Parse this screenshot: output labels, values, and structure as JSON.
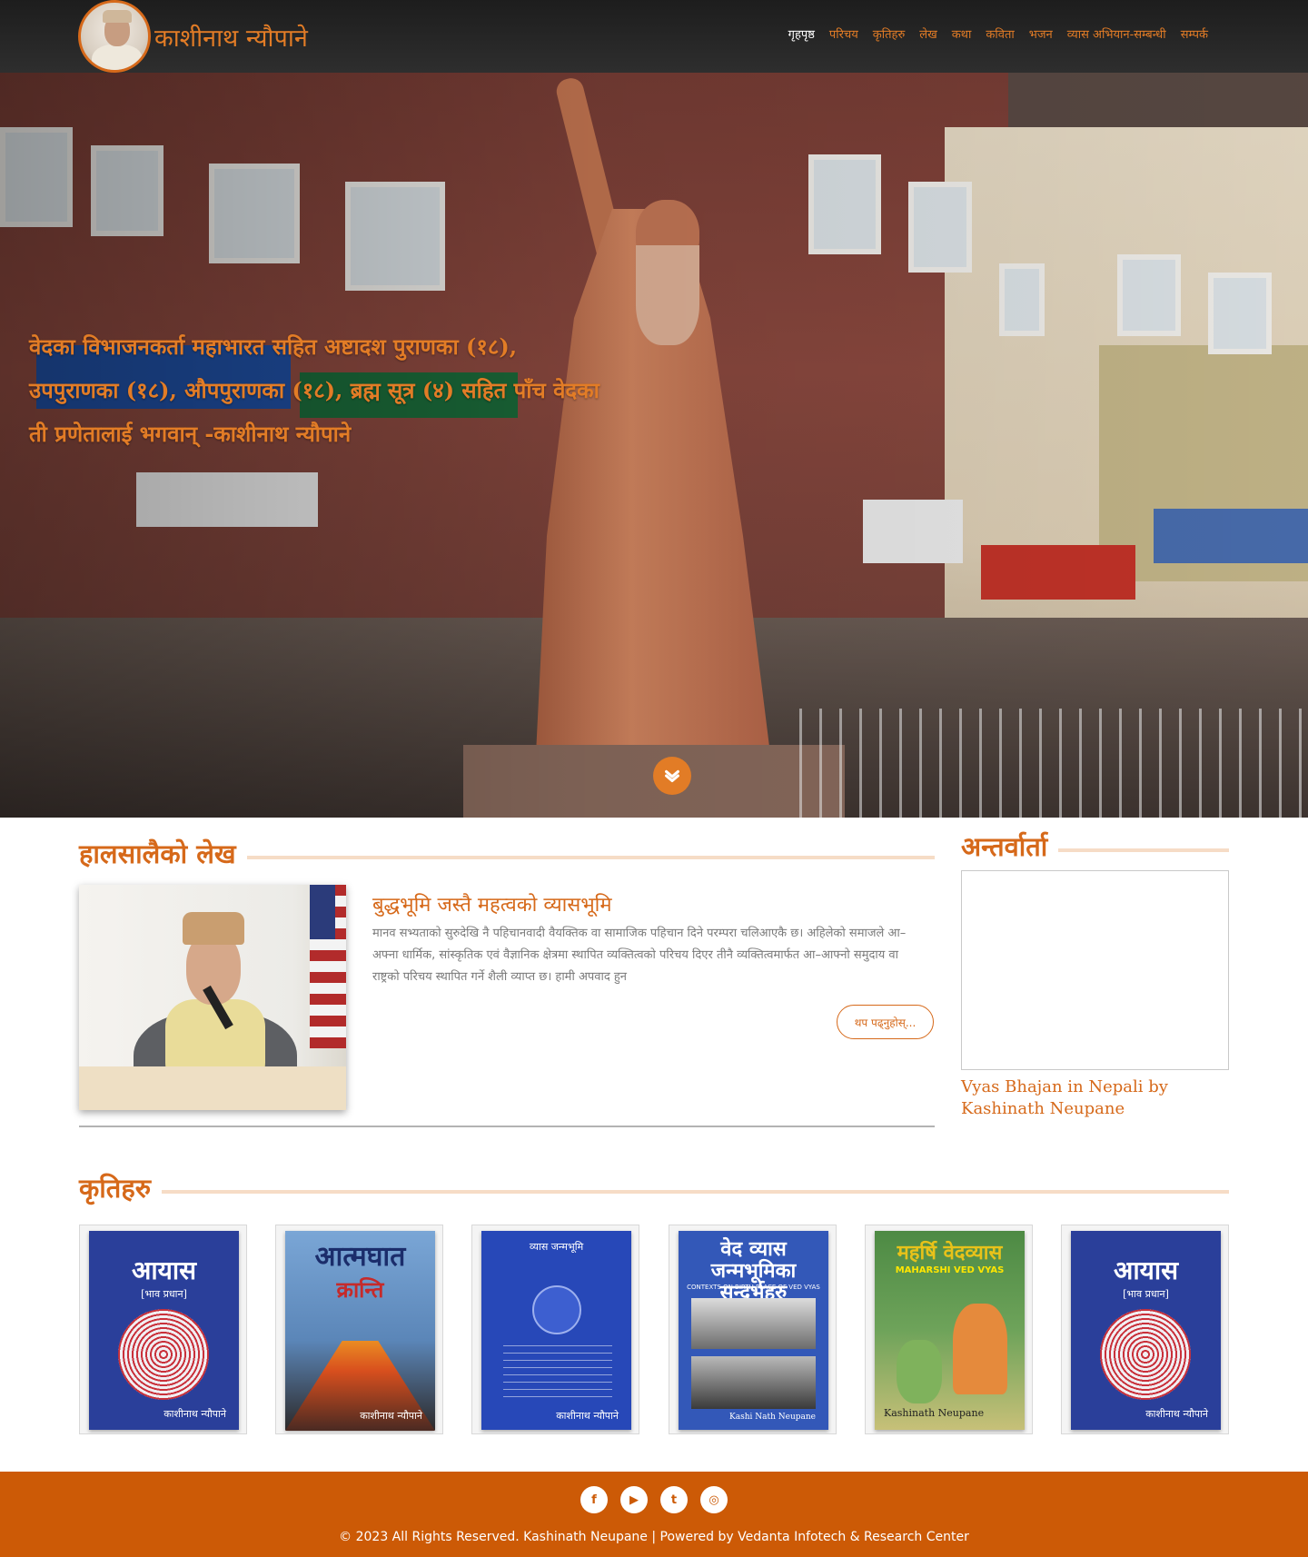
{
  "header": {
    "site_name": "काशीनाथ न्यौपाने",
    "nav": [
      {
        "label": "गृहपृष्ठ",
        "active": true
      },
      {
        "label": "परिचय",
        "active": false
      },
      {
        "label": "कृतिहरु",
        "active": false
      },
      {
        "label": "लेख",
        "active": false
      },
      {
        "label": "कथा",
        "active": false
      },
      {
        "label": "कविता",
        "active": false
      },
      {
        "label": "भजन",
        "active": false
      },
      {
        "label": "व्यास अभियान-सम्बन्धी",
        "active": false
      },
      {
        "label": "सम्पर्क",
        "active": false
      }
    ]
  },
  "hero": {
    "quote": "वेदका विभाजनकर्ता महाभारत सहित अष्टादश पुराणका (१८), उपपुराणका (१८), औपपुराणका (१८), ब्रह्म सूत्र (४) सहित पाँच वेदका ती प्रणेतालाई भगवान्‌ -काशीनाथ न्यौपाने"
  },
  "recent": {
    "heading": "हालसालैको लेख",
    "article": {
      "title": "बुद्धभूमि जस्तै महत्वको व्यासभूमि",
      "excerpt": "मानव सभ्यताको सुरुदेखि नै पहिचानवादी वैयक्तिक वा सामाजिक पहिचान दिने परम्परा चलिआएकै छ। अहिलेको समाजले आ–अफ्ना धार्मिक, सांस्कृतिक एवं वैज्ञानिक क्षेत्रमा स्थापित व्यक्तित्वको परिचय दिएर तीनै व्यक्तित्वमार्फत आ–आफ्नो समुदाय वा राष्ट्रको परिचय स्थापित गर्ने शैली व्याप्त छ। हामी अपवाद हुन",
      "read_more": "थप पढ्नुहोस्..."
    }
  },
  "interview": {
    "heading": "अन्तर्वार्ता",
    "video_title": "Vyas Bhajan in Nepali by Kashinath Neupane"
  },
  "books": {
    "heading": "कृतिहरु",
    "items": [
      {
        "style": "ayas",
        "title": "आयास",
        "subtitle": "[भाव प्रधान]",
        "author": "काशीनाथ न्यौपाने"
      },
      {
        "style": "atma",
        "title": "आत्मघात",
        "subtitle": "क्रान्ति",
        "author": "काशीनाथ न्यौपाने"
      },
      {
        "style": "vyasa",
        "title": "व्यास जन्मभूमि",
        "subtitle": "",
        "author": "काशीनाथ न्यौपाने"
      },
      {
        "style": "contexts",
        "title": "वेद व्यास जन्मभूमिका सन्दर्भहरु",
        "subtitle": "CONTEXTS ON BIRTH PLACE OF VED VYAS",
        "author": "Kashi Nath Neupane"
      },
      {
        "style": "maharshi",
        "title": "महर्षि वेदव्यास",
        "subtitle": "MAHARSHI VED VYAS",
        "author": "Kashinath Neupane"
      },
      {
        "style": "ayas",
        "title": "आयास",
        "subtitle": "[भाव प्रधान]",
        "author": "काशीनाथ न्यौपाने"
      }
    ]
  },
  "footer": {
    "socials": [
      {
        "name": "facebook",
        "glyph": "f"
      },
      {
        "name": "youtube",
        "glyph": "▶"
      },
      {
        "name": "twitter",
        "glyph": "t"
      },
      {
        "name": "instagram",
        "glyph": "◎"
      }
    ],
    "copyright": "© 2023 All Rights Reserved. Kashinath Neupane | Powered by Vedanta Infotech & Research Center"
  },
  "colors": {
    "accent": "#d6691a",
    "footer": "#cc5a06",
    "header": "#222222"
  }
}
